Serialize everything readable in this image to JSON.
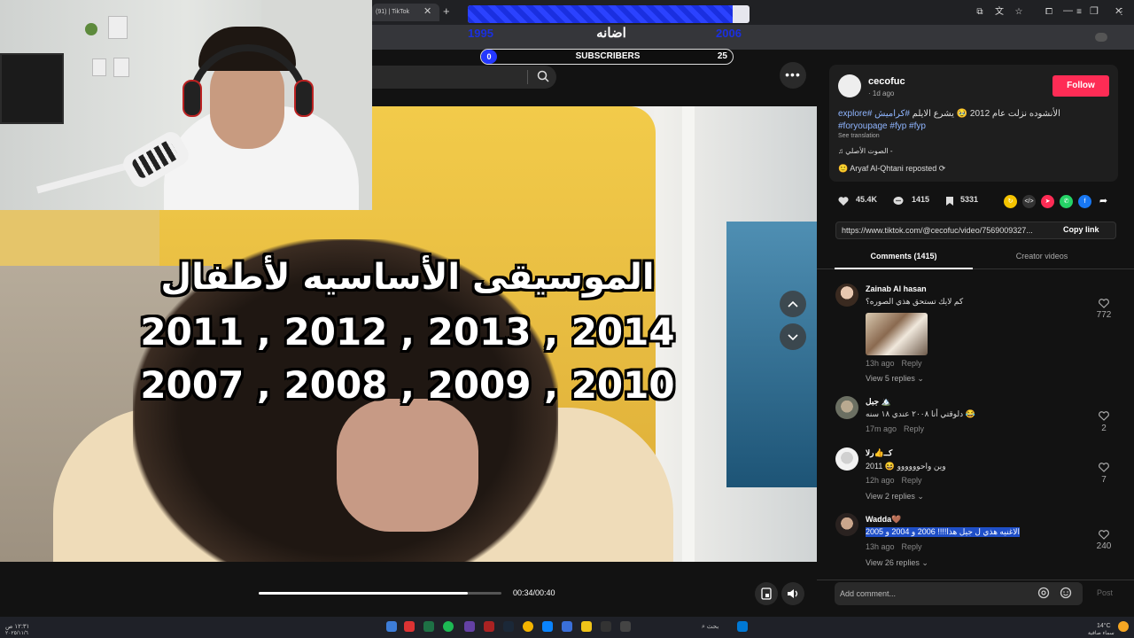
{
  "browser": {
    "tab_title": "(91) | TikTok"
  },
  "overlay": {
    "goal_title": "اضانه",
    "goal_left": "1995",
    "goal_right": "2006",
    "goal_progress": 0.94,
    "sub_start": "0",
    "sub_label": "SUBSCRIBERS",
    "sub_end": "25"
  },
  "video": {
    "caption_line1": "الموسيقى الأساسيه لأطفال",
    "caption_line2": "2011 , 2012 , 2013 , 2014",
    "caption_line3": "2007 , 2008 , 2009 , 2010",
    "time": "00:34/00:40",
    "progress": 0.86
  },
  "post": {
    "username": "cecofuc",
    "posted": "· 1d ago",
    "follow_label": "Follow",
    "desc_text": "الأنشوده نزلت عام 2012 🥹 يشرع الايلم ",
    "tags": "#كراميش #explore #foryoupage #fyp #fyp",
    "see_translation": "See translation",
    "sound": "♫ الصوت الأصلي - ",
    "repost": "Aryaf Al-Qhtani reposted",
    "likes": "45.4K",
    "comments": "1415",
    "saves": "5331",
    "link": "https://www.tiktok.com/@cecofuc/video/7569009327...",
    "copy_link": "Copy link"
  },
  "tabs": {
    "comments": "Comments (1415)",
    "creator": "Creator videos"
  },
  "comments": [
    {
      "user": "Zainab Al hasan",
      "text": "كم لايك تستحق هذي الصوره؟",
      "time": "13h ago",
      "reply": "Reply",
      "view": "View 5 replies",
      "likes": "772"
    },
    {
      "user": "جبل 🏔️",
      "text": "دلوقتي أنا ٢٠٠٨ عندي ١٨ سنه 😂",
      "time": "17m ago",
      "reply": "Reply",
      "view": "",
      "likes": "2"
    },
    {
      "user": "كــ👍رلا",
      "text": "وين واحوووووو 😆 2011",
      "time": "12h ago",
      "reply": "Reply",
      "view": "View 2 replies",
      "likes": "7"
    },
    {
      "user": "Wadda🤎",
      "text": "الاغنيه هذي ل جيل هذا!!!! 2006 و 2004 و 2005",
      "time": "13h ago",
      "reply": "Reply",
      "view": "View 26 replies",
      "likes": "240"
    }
  ],
  "comment_bar": {
    "placeholder": "Add comment...",
    "post": "Post"
  },
  "taskbar": {
    "search": "بحث",
    "weather": "14°C",
    "weather_desc": "سماء صافية",
    "clock": "١٢:٣١ ص",
    "date": "٢٠٢٥/١١/٦"
  },
  "colors": {
    "accent": "#fe2c55",
    "goal_blue": "#1a2fe0",
    "highlight": "#1f4fc8"
  }
}
